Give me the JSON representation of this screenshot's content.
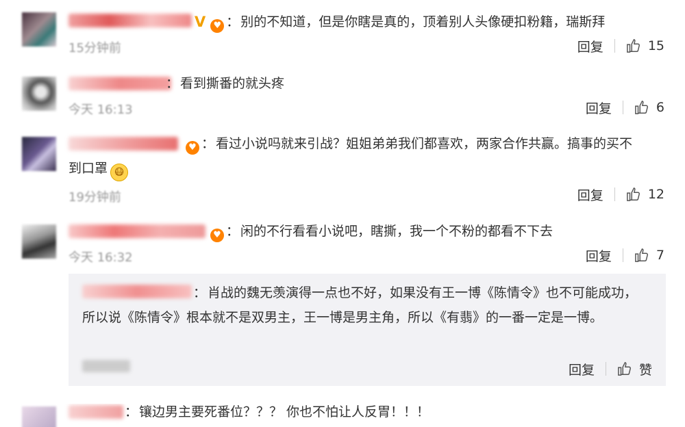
{
  "comments": [
    {
      "text": "别的不知道，但是你瞎是真的，顶着别人头像硬扣粉籍，瑞斯拜",
      "time": "15分钟前",
      "reply_label": "回复",
      "likes": "15"
    },
    {
      "text": "看到撕番的就头疼",
      "time": "今天 16:13",
      "reply_label": "回复",
      "likes": "6"
    },
    {
      "text_line1": "看过小说吗就来引战？姐姐弟弟我们都喜欢，两家合作共赢。搞事的买不",
      "text_line2": "到口罩",
      "time": "19分钟前",
      "reply_label": "回复",
      "likes": "12"
    },
    {
      "text": "闲的不行看看小说吧，瞎撕，我一个不粉的都看不下去",
      "time": "今天 16:32",
      "reply_label": "回复",
      "likes": "7"
    },
    {
      "text": "镶边男主要死番位？？？ 你也不怕让人反胃！！！"
    }
  ],
  "nested_reply": {
    "text": "肖战的魏无羡演得一点也不好，如果没有王一博《陈情令》也不可能成功，所以说《陈情令》根本就不是双男主，王一博是男主角，所以《有翡》的一番一定是一博。",
    "reply_label": "回复",
    "like_label": "赞"
  },
  "colon": "：",
  "verified_mark": "V",
  "emoji_icon": "mask-face",
  "like_icon": "thumbs-up",
  "badge_icon": "fan-badge",
  "accent": "#ff8200"
}
